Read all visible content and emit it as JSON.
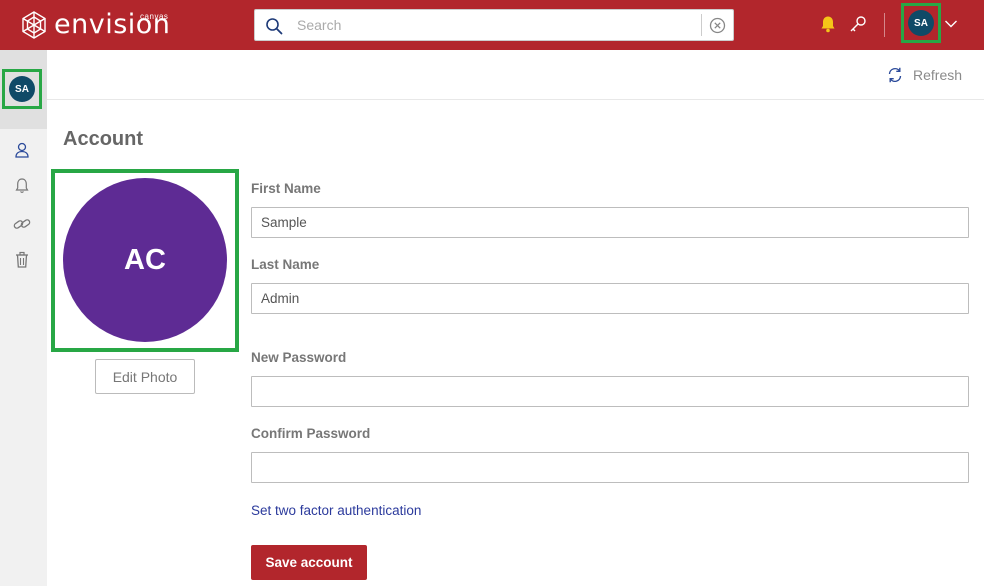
{
  "header": {
    "brand_name": "envision",
    "brand_sub": "canvas",
    "search_placeholder": "Search",
    "user_initials": "SA",
    "icons": [
      "logo-mark-icon",
      "search-icon",
      "clear-icon",
      "bell-icon",
      "key-icon",
      "chevron-down-icon"
    ]
  },
  "sidebar": {
    "user_initials": "SA",
    "items": [
      {
        "name": "profile",
        "icon": "user-icon"
      },
      {
        "name": "notifications",
        "icon": "bell-icon"
      },
      {
        "name": "links",
        "icon": "link-icon"
      },
      {
        "name": "trash",
        "icon": "trash-icon"
      }
    ]
  },
  "toolbar": {
    "refresh_label": "Refresh"
  },
  "account": {
    "title": "Account",
    "photo_initials": "AC",
    "edit_photo_label": "Edit Photo",
    "first_name_label": "First Name",
    "first_name_value": "Sample",
    "last_name_label": "Last Name",
    "last_name_value": "Admin",
    "new_password_label": "New Password",
    "new_password_value": "",
    "confirm_password_label": "Confirm Password",
    "confirm_password_value": "",
    "two_factor_link": "Set two factor authentication",
    "save_label": "Save account"
  },
  "colors": {
    "brand_red": "#b2262c",
    "avatar_blue": "#0f4a67",
    "photo_purple": "#5e2b94",
    "highlight_green": "#28a745",
    "bell_yellow": "#f5c518",
    "link_blue": "#2b3a9c"
  }
}
